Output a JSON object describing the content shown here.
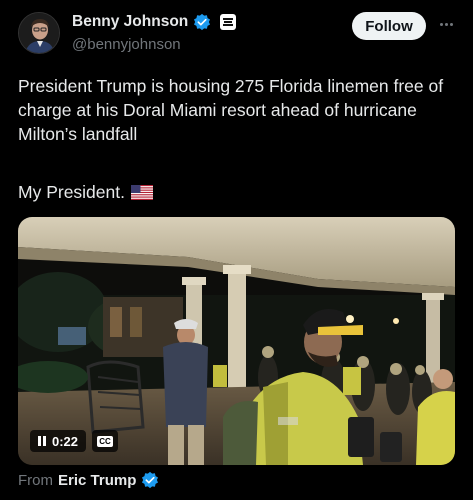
{
  "author": {
    "display_name": "Benny Johnson",
    "handle": "@bennyjohnson",
    "verified_color": "#1d9bf0"
  },
  "actions": {
    "follow_label": "Follow",
    "more_icon": "more-horizontal-icon"
  },
  "tweet": {
    "text": "President Trump is housing 275 Florida linemen free of charge at his Doral Miami resort ahead of hurricane Milton’s landfall",
    "text2": "My President.",
    "emoji": "us-flag-icon"
  },
  "media": {
    "type": "video",
    "time": "0:22",
    "state_icon": "pause-icon",
    "captions_label": "CC"
  },
  "attribution": {
    "from_label": "From",
    "from_name": "Eric Trump"
  }
}
